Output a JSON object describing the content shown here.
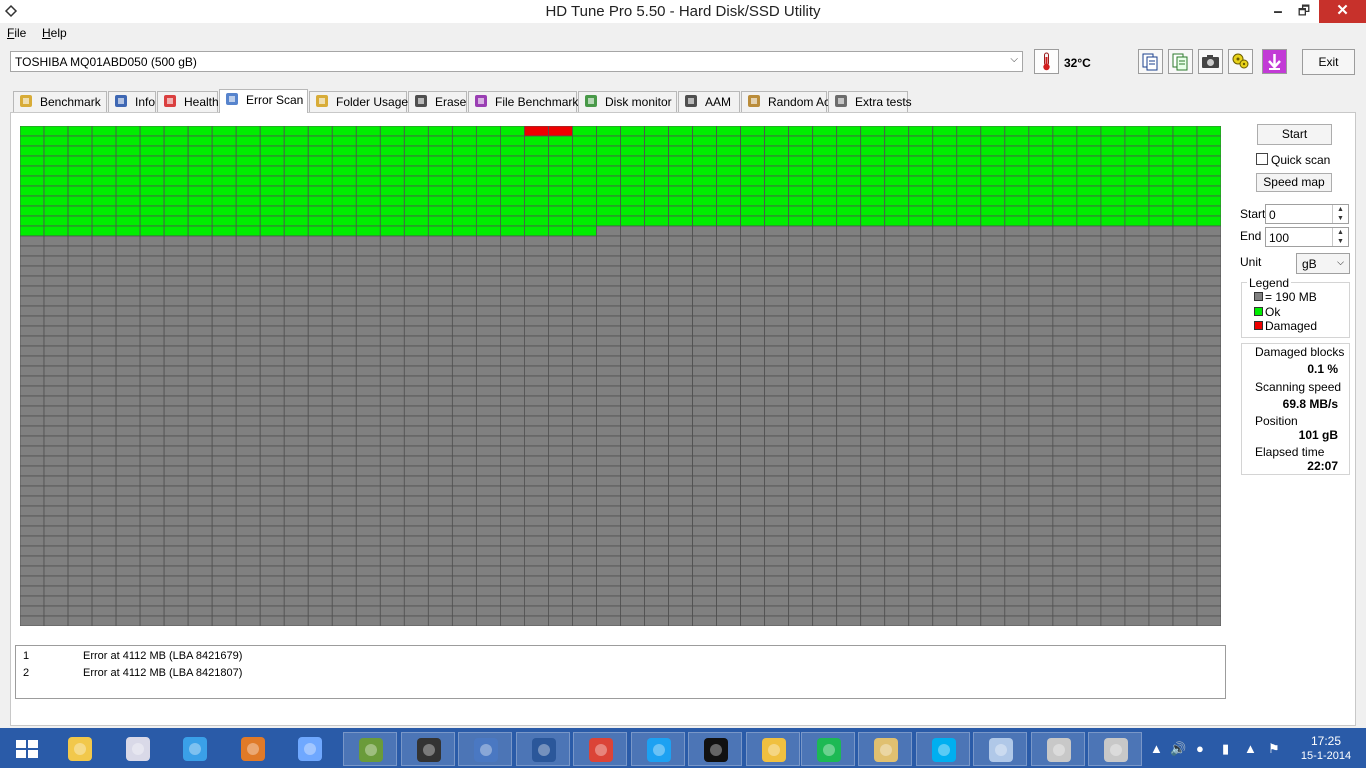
{
  "window": {
    "title": "HD Tune Pro 5.50 - Hard Disk/SSD Utility",
    "minimize_glyph": "🗕",
    "maximize_glyph": "🗗",
    "close_glyph": "✕"
  },
  "menu": {
    "items": [
      {
        "label_first": "F",
        "label_rest": "ile"
      },
      {
        "label_first": "H",
        "label_rest": "elp"
      }
    ]
  },
  "drive": {
    "selected": "TOSHIBA MQ01ABD050 (500 gB)",
    "temperature": "32°C"
  },
  "toolbar": {
    "icons": [
      "copy-info-icon",
      "copy-text-icon",
      "screenshot-icon",
      "options-icon",
      "save-icon"
    ],
    "exit_label": "Exit"
  },
  "tabs": [
    {
      "label": "Benchmark",
      "icon": "benchmark-icon"
    },
    {
      "label": "Info",
      "icon": "info-icon"
    },
    {
      "label": "Health",
      "icon": "health-icon"
    },
    {
      "label": "Error Scan",
      "icon": "error-scan-icon",
      "active": true
    },
    {
      "label": "Folder Usage",
      "icon": "folder-icon"
    },
    {
      "label": "Erase",
      "icon": "erase-icon"
    },
    {
      "label": "File Benchmark",
      "icon": "file-benchmark-icon"
    },
    {
      "label": "Disk monitor",
      "icon": "disk-monitor-icon"
    },
    {
      "label": "AAM",
      "icon": "speaker-icon"
    },
    {
      "label": "Random Access",
      "icon": "random-access-icon"
    },
    {
      "label": "Extra tests",
      "icon": "extra-tests-icon"
    }
  ],
  "scan_grid": {
    "columns": 50,
    "rows": 50,
    "scanned_blocks": 524,
    "damaged_blocks": [
      21,
      22
    ],
    "colors": {
      "ok": "#00ee00",
      "damaged": "#ee0000",
      "unscanned": "#808080",
      "lines": "#505050"
    }
  },
  "controls": {
    "start_label": "Start",
    "quick_scan_label": "Quick scan",
    "quick_scan_checked": false,
    "speed_map_label": "Speed map",
    "start_field_label": "Start",
    "start_value": "0",
    "end_field_label": "End",
    "end_value": "100",
    "unit_label": "Unit",
    "unit_value": "gB"
  },
  "legend": {
    "title": "Legend",
    "block_size": "= 190 MB",
    "ok_label": "Ok",
    "damaged_label": "Damaged"
  },
  "stats": {
    "damaged_label": "Damaged blocks",
    "damaged_value": "0.1 %",
    "speed_label": "Scanning speed",
    "speed_value": "69.8 MB/s",
    "position_label": "Position",
    "position_value": "101 gB",
    "elapsed_label": "Elapsed time",
    "elapsed_value": "22:07"
  },
  "errors": [
    {
      "num": "1",
      "msg": "Error at 4112 MB (LBA 8421679)"
    },
    {
      "num": "2",
      "msg": "Error at 4112 MB (LBA 8421807)"
    }
  ],
  "taskbar": {
    "apps": [
      {
        "name": "start-button-icon",
        "color": "#ffffff"
      },
      {
        "name": "file-explorer-icon",
        "color": "#f2c84b"
      },
      {
        "name": "control-panel-icon",
        "color": "#d9d9e8"
      },
      {
        "name": "internet-explorer-icon",
        "color": "#3aa0e8"
      },
      {
        "name": "audio-tool-icon",
        "color": "#e07a28"
      },
      {
        "name": "app-tb-icon",
        "color": "#6fa8ff"
      },
      {
        "name": "minecraft-icon",
        "color": "#6a9b3a"
      },
      {
        "name": "movie-maker-icon",
        "color": "#333333"
      },
      {
        "name": "writer-icon",
        "color": "#4a78c2"
      },
      {
        "name": "word-icon",
        "color": "#2b579a"
      },
      {
        "name": "chrome-icon",
        "color": "#db4437"
      },
      {
        "name": "twitter-icon",
        "color": "#1da1f2"
      },
      {
        "name": "media-player-icon",
        "color": "#111111"
      },
      {
        "name": "hdtune-icon",
        "color": "#f0c040"
      },
      {
        "name": "spotify-icon",
        "color": "#1db954"
      },
      {
        "name": "wordpad-icon",
        "color": "#e0c070"
      },
      {
        "name": "skype-icon",
        "color": "#00aff0"
      },
      {
        "name": "network-icon",
        "color": "#b0c8e8"
      },
      {
        "name": "usb-drive-icon",
        "color": "#c8c8c8"
      },
      {
        "name": "usb-drive-2-icon",
        "color": "#c8c8c8"
      }
    ],
    "time": "17:25",
    "date": "15-1-2014"
  }
}
